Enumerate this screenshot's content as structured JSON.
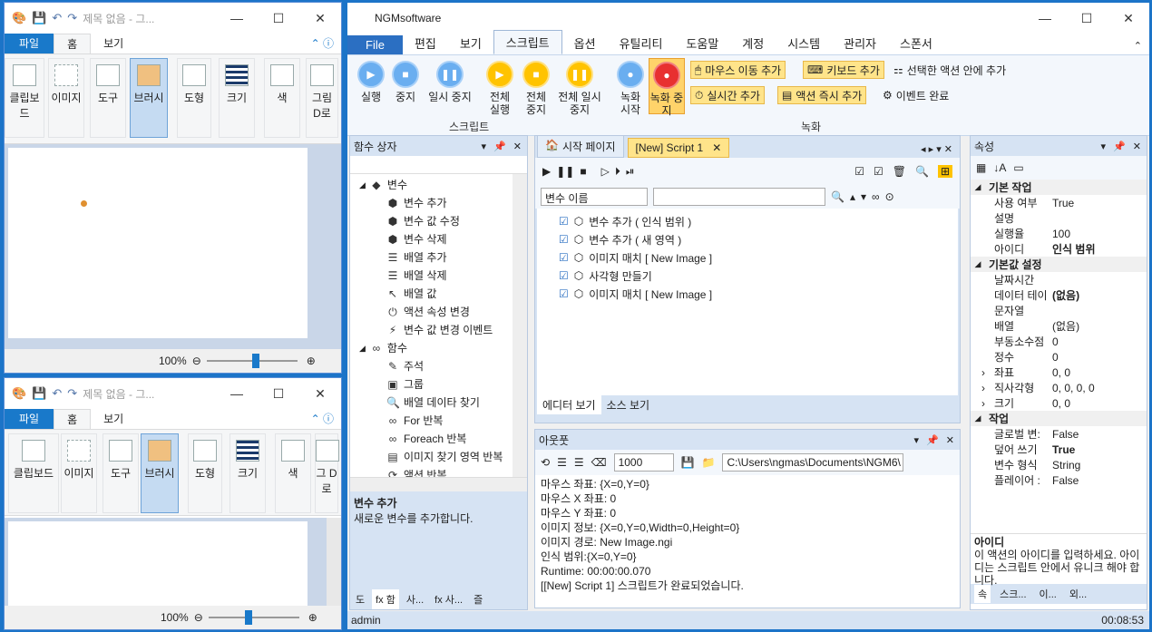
{
  "paint_top": {
    "title": "제목 없음 - 그...",
    "tabs": [
      {
        "label": "파일"
      },
      {
        "label": "홈"
      },
      {
        "label": "보기"
      }
    ],
    "groups": [
      {
        "label": "클립보드"
      },
      {
        "label": "이미지"
      },
      {
        "label": "도구"
      },
      {
        "label": "브러시"
      },
      {
        "label": "도형"
      },
      {
        "label": "크기"
      },
      {
        "label": "색"
      },
      {
        "label": "그림 D로"
      }
    ],
    "zoom": "100%"
  },
  "paint_bottom": {
    "title": "제목 없음 - 그...",
    "tabs": [
      {
        "label": "파일"
      },
      {
        "label": "홈"
      },
      {
        "label": "보기"
      }
    ],
    "groups": [
      {
        "label": "클립보드"
      },
      {
        "label": "이미지"
      },
      {
        "label": "도구"
      },
      {
        "label": "브러시"
      },
      {
        "label": "도형"
      },
      {
        "label": "크기"
      },
      {
        "label": "색"
      },
      {
        "label": "그 D로"
      }
    ],
    "zoom": "100%"
  },
  "ngm": {
    "title": "NGMsoftware",
    "menu": [
      {
        "label": "File"
      },
      {
        "label": "편집"
      },
      {
        "label": "보기"
      },
      {
        "label": "스크립트"
      },
      {
        "label": "옵션"
      },
      {
        "label": "유틸리티"
      },
      {
        "label": "도움말"
      },
      {
        "label": "계정"
      },
      {
        "label": "시스템"
      },
      {
        "label": "관리자"
      },
      {
        "label": "스폰서"
      }
    ],
    "ribbon": {
      "script_buttons": [
        {
          "label": "실행"
        },
        {
          "label": "중지"
        },
        {
          "label": "일시 중지"
        },
        {
          "label": "전체 실행"
        },
        {
          "label": "전체 중지"
        },
        {
          "label": "전체 일시 중지"
        }
      ],
      "script_group": "스크립트",
      "record_buttons": [
        {
          "label": "녹화 시작"
        },
        {
          "label": "녹화 중지"
        }
      ],
      "record_actions": [
        "마우스 이동 추가",
        "키보드 추가",
        "선택한 액션 안에 추가",
        "실시간 추가",
        "액션 즉시 추가",
        "이벤트 완료"
      ],
      "record_group": "녹화"
    },
    "function_box": {
      "title": "함수 상자",
      "items": [
        {
          "label": "변수",
          "level": 0,
          "icon": "◆"
        },
        {
          "label": "변수 추가",
          "level": 1,
          "icon": "⬢"
        },
        {
          "label": "변수 값 수정",
          "level": 1,
          "icon": "⬢"
        },
        {
          "label": "변수 삭제",
          "level": 1,
          "icon": "⬢"
        },
        {
          "label": "배열 추가",
          "level": 1,
          "icon": "☰"
        },
        {
          "label": "배열 삭제",
          "level": 1,
          "icon": "☰"
        },
        {
          "label": "배열 값",
          "level": 1,
          "icon": "↖"
        },
        {
          "label": "액션 속성 변경",
          "level": 1,
          "icon": "⏻"
        },
        {
          "label": "변수 값 변경 이벤트",
          "level": 1,
          "icon": "⚡"
        },
        {
          "label": "함수",
          "level": 0,
          "icon": "∞"
        },
        {
          "label": "주석",
          "level": 1,
          "icon": "✎"
        },
        {
          "label": "그룹",
          "level": 1,
          "icon": "▣"
        },
        {
          "label": "배열 데이타 찾기",
          "level": 1,
          "icon": "🔍"
        },
        {
          "label": "For 반복",
          "level": 1,
          "icon": "∞"
        },
        {
          "label": "Foreach 반복",
          "level": 1,
          "icon": "∞"
        },
        {
          "label": "이미지 찾기 영역 반복",
          "level": 1,
          "icon": "▤"
        },
        {
          "label": "액션 반복",
          "level": 1,
          "icon": "⟳"
        }
      ],
      "desc_title": "변수 추가",
      "desc_text": "새로운 변수를 추가합니다.",
      "bottom_tabs": [
        "도",
        "fx 함",
        "사...",
        "fx 사...",
        "즐"
      ]
    },
    "editor": {
      "tabs": [
        {
          "label": "시작 페이지"
        },
        {
          "label": "[New] Script 1"
        }
      ],
      "filter_select": "변수 이름",
      "filter_value": "",
      "lines": [
        {
          "text": "변수 추가 ( 인식 범위 )"
        },
        {
          "text": "변수 추가 ( 새 영역 )"
        },
        {
          "text": "이미지 매치 [ New Image ]"
        },
        {
          "text": "사각형 만들기"
        },
        {
          "text": "이미지 매치 [ New Image ]"
        }
      ],
      "view_tabs": [
        {
          "label": "에디터 보기"
        },
        {
          "label": "소스 보기"
        }
      ]
    },
    "output": {
      "title": "아웃풋",
      "limit": "1000",
      "path": "C:\\Users\\ngmas\\Documents\\NGM6\\",
      "lines": [
        "마우스 좌표: {X=0,Y=0}",
        "마우스 X 좌표: 0",
        "마우스 Y 좌표: 0",
        "이미지 정보: {X=0,Y=0,Width=0,Height=0}",
        "이미지 경로: New Image.ngi",
        "인식 범위:{X=0,Y=0}",
        "Runtime: 00:00:00.070",
        "[[New] Script 1] 스크립트가 완료되었습니다."
      ]
    },
    "properties": {
      "title": "속성",
      "rows": [
        {
          "cat": true,
          "k": "기본 작업",
          "v": ""
        },
        {
          "k": "사용 여부",
          "v": "True"
        },
        {
          "k": "설명",
          "v": ""
        },
        {
          "k": "실행율",
          "v": "100"
        },
        {
          "k": "아이디",
          "v": "인식 범위",
          "b": true
        },
        {
          "cat": true,
          "k": "기본값 설정",
          "v": ""
        },
        {
          "k": "날짜시간",
          "v": ""
        },
        {
          "k": "데이터 테이",
          "v": "(없음)",
          "b": true
        },
        {
          "k": "문자열",
          "v": ""
        },
        {
          "k": "배열",
          "v": "(없음)"
        },
        {
          "k": "부동소수점",
          "v": "0"
        },
        {
          "k": "정수",
          "v": "0"
        },
        {
          "k": "좌표",
          "v": "0, 0",
          "exp": true
        },
        {
          "k": "직사각형",
          "v": "0, 0, 0, 0",
          "exp": true
        },
        {
          "k": "크기",
          "v": "0, 0",
          "exp": true
        },
        {
          "cat": true,
          "k": "작업",
          "v": ""
        },
        {
          "k": "글로벌 변:",
          "v": "False"
        },
        {
          "k": "덮어 쓰기",
          "v": "True",
          "b": true
        },
        {
          "k": "변수 형식",
          "v": "String"
        },
        {
          "k": "플레이어 :",
          "v": "False"
        }
      ],
      "desc_title": "아이디",
      "desc_text": "이 액션의 아이디를 입력하세요. 아이디는 스크립트 안에서 유니크 해야 합니다.",
      "bottom_tabs": [
        "속",
        "스크...",
        "이...",
        "외..."
      ]
    },
    "status_user": "admin",
    "status_time": "00:08:53"
  },
  "colors": {
    "accent": "#1979ca",
    "highlight": "#ffe48a",
    "panel_head": "#d6e3f3"
  }
}
